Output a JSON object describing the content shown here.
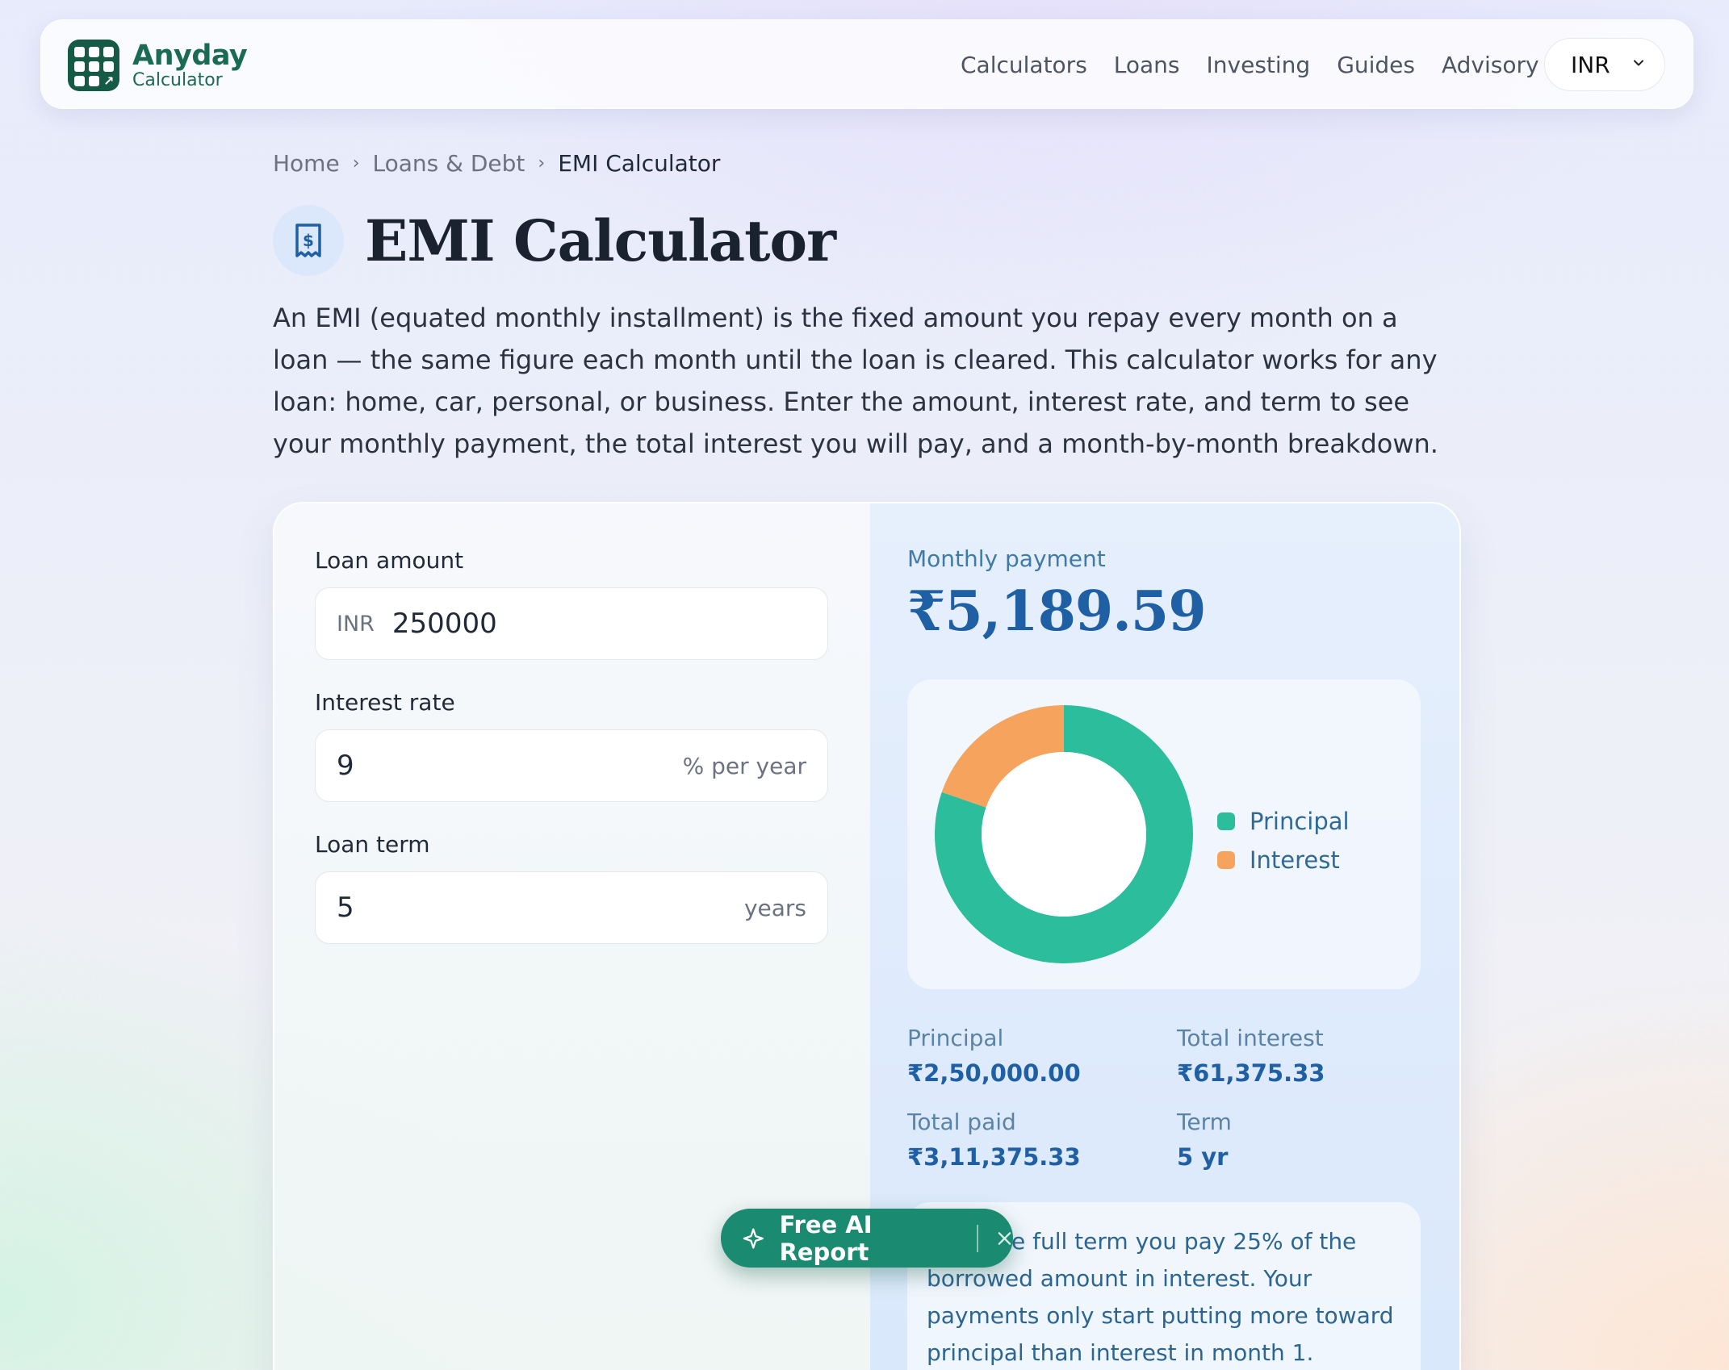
{
  "nav": {
    "brand_name": "Anyday",
    "brand_sub": "Calculator",
    "links": [
      "Calculators",
      "Loans",
      "Investing",
      "Guides",
      "Advisory"
    ],
    "currency": "INR"
  },
  "breadcrumb": [
    "Home",
    "Loans & Debt",
    "EMI Calculator"
  ],
  "page": {
    "title": "EMI Calculator",
    "intro": "An EMI (equated monthly installment) is the fixed amount you repay every month on a loan — the same figure each month until the loan is cleared. This calculator works for any loan: home, car, personal, or business. Enter the amount, interest rate, and term to see your monthly payment, the total interest you will pay, and a month-by-month breakdown."
  },
  "form": {
    "loan_amount": {
      "label": "Loan amount",
      "prefix": "INR",
      "value": "250000"
    },
    "interest_rate": {
      "label": "Interest rate",
      "value": "9",
      "suffix": "% per year"
    },
    "loan_term": {
      "label": "Loan term",
      "value": "5",
      "suffix": "years"
    }
  },
  "result": {
    "monthly_label": "Monthly payment",
    "monthly_value": "₹5,189.59",
    "legend": {
      "principal": "Principal",
      "interest": "Interest"
    },
    "stats": {
      "principal": {
        "label": "Principal",
        "value": "₹2,50,000.00"
      },
      "total_interest": {
        "label": "Total interest",
        "value": "₹61,375.33"
      },
      "total_paid": {
        "label": "Total paid",
        "value": "₹3,11,375.33"
      },
      "term": {
        "label": "Term",
        "value": "5 yr"
      }
    },
    "note": "Over the full term you pay 25% of the borrowed amount in interest. Your payments only start putting more toward principal than interest in month 1."
  },
  "chart_data": {
    "type": "pie",
    "categories": [
      "Principal",
      "Interest"
    ],
    "values": [
      250000.0,
      61375.33
    ],
    "colors": [
      "#2bbd9c",
      "#f6a35e"
    ]
  },
  "ai_button": {
    "label": "Free AI Report"
  },
  "colors": {
    "brand": "#145a45",
    "accent_blue": "#1f5fa3",
    "teal": "#2bbd9c",
    "orange": "#f6a35e"
  }
}
